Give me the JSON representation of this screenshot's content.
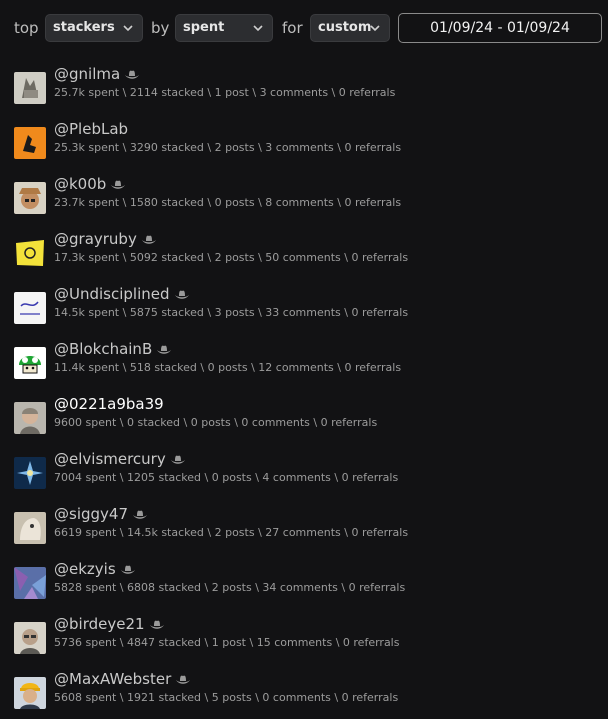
{
  "filters": {
    "top_label": "top",
    "type_value": "stackers",
    "by_label": "by",
    "sort_value": "spent",
    "for_label": "for",
    "range_value": "custom",
    "date_range": "01/09/24 - 01/09/24"
  },
  "icons": {
    "dropdown": "chevron-down-icon",
    "hat": "cowboy-hat-icon"
  },
  "colors": {
    "background": "#121214",
    "select_bg": "#2c2d30"
  },
  "users": [
    {
      "name": "@gnilma",
      "spent": "25.7k spent",
      "stacked": "2114 stacked",
      "posts": "1 post",
      "comments": "3 comments",
      "referrals": "0 referrals",
      "hat": true
    },
    {
      "name": "@PlebLab",
      "spent": "25.3k spent",
      "stacked": "3290 stacked",
      "posts": "2 posts",
      "comments": "3 comments",
      "referrals": "0 referrals",
      "hat": false
    },
    {
      "name": "@k00b",
      "spent": "23.7k spent",
      "stacked": "1580 stacked",
      "posts": "0 posts",
      "comments": "8 comments",
      "referrals": "0 referrals",
      "hat": true
    },
    {
      "name": "@grayruby",
      "spent": "17.3k spent",
      "stacked": "5092 stacked",
      "posts": "2 posts",
      "comments": "50 comments",
      "referrals": "0 referrals",
      "hat": true
    },
    {
      "name": "@Undisciplined",
      "spent": "14.5k spent",
      "stacked": "5875 stacked",
      "posts": "3 posts",
      "comments": "33 comments",
      "referrals": "0 referrals",
      "hat": true
    },
    {
      "name": "@BlokchainB",
      "spent": "11.4k spent",
      "stacked": "518 stacked",
      "posts": "0 posts",
      "comments": "12 comments",
      "referrals": "0 referrals",
      "hat": true
    },
    {
      "name": "@0221a9ba39",
      "spent": "9600 spent",
      "stacked": "0 stacked",
      "posts": "0 posts",
      "comments": "0 comments",
      "referrals": "0 referrals",
      "hat": false
    },
    {
      "name": "@elvismercury",
      "spent": "7004 spent",
      "stacked": "1205 stacked",
      "posts": "0 posts",
      "comments": "4 comments",
      "referrals": "0 referrals",
      "hat": true
    },
    {
      "name": "@siggy47",
      "spent": "6619 spent",
      "stacked": "14.5k stacked",
      "posts": "2 posts",
      "comments": "27 comments",
      "referrals": "0 referrals",
      "hat": true
    },
    {
      "name": "@ekzyis",
      "spent": "5828 spent",
      "stacked": "6808 stacked",
      "posts": "2 posts",
      "comments": "34 comments",
      "referrals": "0 referrals",
      "hat": true
    },
    {
      "name": "@birdeye21",
      "spent": "5736 spent",
      "stacked": "4847 stacked",
      "posts": "1 post",
      "comments": "15 comments",
      "referrals": "0 referrals",
      "hat": true
    },
    {
      "name": "@MaxAWebster",
      "spent": "5608 spent",
      "stacked": "1921 stacked",
      "posts": "5 posts",
      "comments": "0 comments",
      "referrals": "0 referrals",
      "hat": true
    }
  ]
}
